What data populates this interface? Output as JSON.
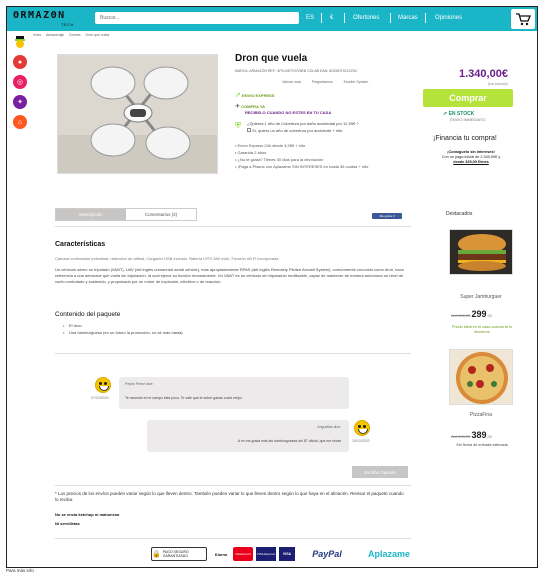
{
  "header": {
    "logo": "ΘRMAZΘN",
    "logo_sub": "TECH",
    "search_placeholder": "Buscar...",
    "lang": "ES",
    "currency": "€",
    "links": [
      "Ofertones",
      "Marcas",
      "Opiniones"
    ]
  },
  "sidebar": {
    "icons": [
      "mascot-icon",
      "category-red-icon",
      "category-pink-icon",
      "category-violet-icon",
      "home-icon"
    ]
  },
  "breadcrumb": [
    "Inicio",
    "Almacenaje",
    "Drones",
    "Dron que vuela"
  ],
  "product": {
    "title": "Dron que vuela",
    "meta": "MARCA: ARMAZON    REF.: 4FDJ4KTGVV5EB COLAB    EAN: 8XZ567HG1ZZ04",
    "meta_links": [
      "Valorar nota",
      "Preguntamos",
      "Escribir Opinión"
    ],
    "express": "ENVIO EXPRESS",
    "compra_label": "COMPRA YA",
    "compra_sub": "RECIBELO CUANDO NO ESTES EN TU CASA",
    "insure_1": "¿Quieres 1 año de Cobertura por daño accidental por 12,99€ ?",
    "insure_2": "Sí, quiero un año de cobertura por accidente + info",
    "bullets": [
      "Envío Express 24h desde 4,95€ + info",
      "Garantía 2 años",
      "¿No te gusta? Tienes 30 días para la devolución",
      "¡Paga a Plazos con Aplazame SIN INTERESES en hasta 36 cuotas + info"
    ]
  },
  "buy": {
    "price": "1.340,00€",
    "iva": "(Iva incluido)",
    "button": "Comprar",
    "stock": "EN STOCK",
    "stock_sub": "ENVÍO INMEDIATO",
    "financia": "¡Financia tu compra!",
    "fin_1": "¡Consíguelo sin intereses!",
    "fin_2": "Con un pago inicial de 2.340,00€ y",
    "fin_3": "desde 325,00 €/mes"
  },
  "tabs": {
    "desc": "Descripción",
    "comments": "Comentarios (2)"
  },
  "fb_like": "Me gusta 0",
  "description": {
    "heading": "Características",
    "carac": "Cámara controlador individual, retención de altitud, Cargador USB incluido, Batería LiPO 380 mAh, Función Wi-Fi incorporada",
    "text": "Un vehículo aéreo no tripulado (VANT), UAV (del inglés unmanned aerial vehicle), más apropiadamente RPAS (del inglés Remotely Piloted Aircraft System), comúnmente conocido como dron, hace referencia a una aeronave que vuela sin tripulación, la cual ejerce su función remotamente. Un VANT es un vehículo sin tripulación reutilizable, capaz de mantener de manera autónoma un nivel de vuelo controlado y sostenido, y propulsado por un motor de explosión, eléctrico o de reacción.",
    "pack_heading": "Contenido del paquete",
    "pack": [
      "El dron",
      "Una hamburguesa (en un futuro la promoción, no sé más hasta)"
    ]
  },
  "comments": [
    {
      "name": "Pepito Perez dice:",
      "text": "Te necesito en el campo está poco. Te vale que te sobre ganas vuela mejor",
      "date": "07/10/2020"
    },
    {
      "name": "Angustias dice:",
      "text": "A mí me gusta más las hamburguesas del 87 oficial, que me miran",
      "date": "15/10/2020"
    }
  ],
  "write_button": "Escribir Opinión",
  "notes": {
    "n1": "* Los precios de los envíos pueden variar según lo que lleven dentro. También pueden variar lo que lleven dentro según lo que haya en el almacén. Revisar el paquete cuando lo reciba.",
    "n2": "No se envía ketchup ni mahonesa",
    "n3": "Ni servilletas"
  },
  "recs": {
    "heading": "Destacados",
    "items": [
      {
        "name": "Super Jamburguer",
        "old": "Ant 340,00",
        "price": "299",
        "cents": ",00",
        "note": "Precio ideal en tu casa cuando te lo llevemos"
      },
      {
        "name": "PizzaFina",
        "old": "Ant 439,00",
        "price": "389",
        "cents": ",00",
        "note": "Sin fecha de entrada estimada"
      }
    ]
  },
  "payments": [
    "PAGO SEGURO GARANTIZADO",
    "Klarna",
    "Mastercard",
    "VISA Electron",
    "VISA",
    "PayPal",
    "Aplazame"
  ],
  "outside": "Para más info"
}
